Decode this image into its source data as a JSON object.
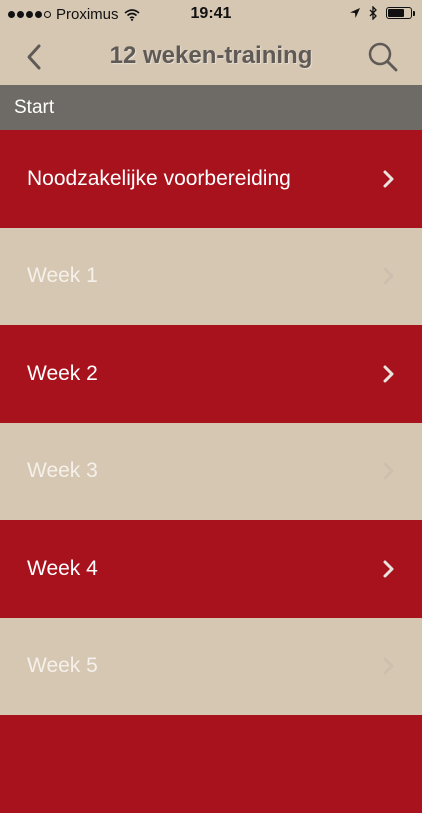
{
  "status_bar": {
    "carrier": "Proximus",
    "time": "19:41"
  },
  "nav": {
    "title": "12 weken-training",
    "back_icon": "chevron-left-icon",
    "search_icon": "search-icon"
  },
  "section": {
    "title": "Start"
  },
  "items": [
    {
      "label": "Noodzakelijke voorbereiding",
      "style": "red"
    },
    {
      "label": "Week 1",
      "style": "tan"
    },
    {
      "label": "Week 2",
      "style": "red"
    },
    {
      "label": "Week 3",
      "style": "tan"
    },
    {
      "label": "Week 4",
      "style": "red"
    },
    {
      "label": "Week 5",
      "style": "tan"
    },
    {
      "label": "",
      "style": "red"
    }
  ],
  "colors": {
    "accent_red": "#a8121d",
    "background_tan": "#d6c7b3",
    "section_gray": "#6e6b66"
  }
}
